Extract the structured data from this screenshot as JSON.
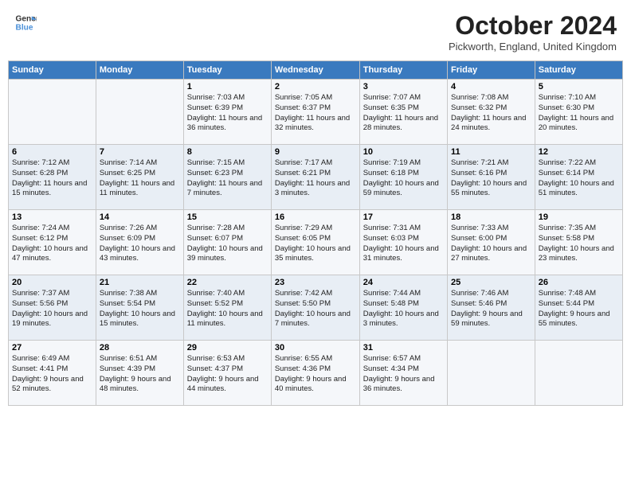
{
  "logo": {
    "line1": "General",
    "line2": "Blue"
  },
  "title": "October 2024",
  "subtitle": "Pickworth, England, United Kingdom",
  "days_of_week": [
    "Sunday",
    "Monday",
    "Tuesday",
    "Wednesday",
    "Thursday",
    "Friday",
    "Saturday"
  ],
  "weeks": [
    [
      {
        "day": "",
        "info": ""
      },
      {
        "day": "",
        "info": ""
      },
      {
        "day": "1",
        "info": "Sunrise: 7:03 AM\nSunset: 6:39 PM\nDaylight: 11 hours and 36 minutes."
      },
      {
        "day": "2",
        "info": "Sunrise: 7:05 AM\nSunset: 6:37 PM\nDaylight: 11 hours and 32 minutes."
      },
      {
        "day": "3",
        "info": "Sunrise: 7:07 AM\nSunset: 6:35 PM\nDaylight: 11 hours and 28 minutes."
      },
      {
        "day": "4",
        "info": "Sunrise: 7:08 AM\nSunset: 6:32 PM\nDaylight: 11 hours and 24 minutes."
      },
      {
        "day": "5",
        "info": "Sunrise: 7:10 AM\nSunset: 6:30 PM\nDaylight: 11 hours and 20 minutes."
      }
    ],
    [
      {
        "day": "6",
        "info": "Sunrise: 7:12 AM\nSunset: 6:28 PM\nDaylight: 11 hours and 15 minutes."
      },
      {
        "day": "7",
        "info": "Sunrise: 7:14 AM\nSunset: 6:25 PM\nDaylight: 11 hours and 11 minutes."
      },
      {
        "day": "8",
        "info": "Sunrise: 7:15 AM\nSunset: 6:23 PM\nDaylight: 11 hours and 7 minutes."
      },
      {
        "day": "9",
        "info": "Sunrise: 7:17 AM\nSunset: 6:21 PM\nDaylight: 11 hours and 3 minutes."
      },
      {
        "day": "10",
        "info": "Sunrise: 7:19 AM\nSunset: 6:18 PM\nDaylight: 10 hours and 59 minutes."
      },
      {
        "day": "11",
        "info": "Sunrise: 7:21 AM\nSunset: 6:16 PM\nDaylight: 10 hours and 55 minutes."
      },
      {
        "day": "12",
        "info": "Sunrise: 7:22 AM\nSunset: 6:14 PM\nDaylight: 10 hours and 51 minutes."
      }
    ],
    [
      {
        "day": "13",
        "info": "Sunrise: 7:24 AM\nSunset: 6:12 PM\nDaylight: 10 hours and 47 minutes."
      },
      {
        "day": "14",
        "info": "Sunrise: 7:26 AM\nSunset: 6:09 PM\nDaylight: 10 hours and 43 minutes."
      },
      {
        "day": "15",
        "info": "Sunrise: 7:28 AM\nSunset: 6:07 PM\nDaylight: 10 hours and 39 minutes."
      },
      {
        "day": "16",
        "info": "Sunrise: 7:29 AM\nSunset: 6:05 PM\nDaylight: 10 hours and 35 minutes."
      },
      {
        "day": "17",
        "info": "Sunrise: 7:31 AM\nSunset: 6:03 PM\nDaylight: 10 hours and 31 minutes."
      },
      {
        "day": "18",
        "info": "Sunrise: 7:33 AM\nSunset: 6:00 PM\nDaylight: 10 hours and 27 minutes."
      },
      {
        "day": "19",
        "info": "Sunrise: 7:35 AM\nSunset: 5:58 PM\nDaylight: 10 hours and 23 minutes."
      }
    ],
    [
      {
        "day": "20",
        "info": "Sunrise: 7:37 AM\nSunset: 5:56 PM\nDaylight: 10 hours and 19 minutes."
      },
      {
        "day": "21",
        "info": "Sunrise: 7:38 AM\nSunset: 5:54 PM\nDaylight: 10 hours and 15 minutes."
      },
      {
        "day": "22",
        "info": "Sunrise: 7:40 AM\nSunset: 5:52 PM\nDaylight: 10 hours and 11 minutes."
      },
      {
        "day": "23",
        "info": "Sunrise: 7:42 AM\nSunset: 5:50 PM\nDaylight: 10 hours and 7 minutes."
      },
      {
        "day": "24",
        "info": "Sunrise: 7:44 AM\nSunset: 5:48 PM\nDaylight: 10 hours and 3 minutes."
      },
      {
        "day": "25",
        "info": "Sunrise: 7:46 AM\nSunset: 5:46 PM\nDaylight: 9 hours and 59 minutes."
      },
      {
        "day": "26",
        "info": "Sunrise: 7:48 AM\nSunset: 5:44 PM\nDaylight: 9 hours and 55 minutes."
      }
    ],
    [
      {
        "day": "27",
        "info": "Sunrise: 6:49 AM\nSunset: 4:41 PM\nDaylight: 9 hours and 52 minutes."
      },
      {
        "day": "28",
        "info": "Sunrise: 6:51 AM\nSunset: 4:39 PM\nDaylight: 9 hours and 48 minutes."
      },
      {
        "day": "29",
        "info": "Sunrise: 6:53 AM\nSunset: 4:37 PM\nDaylight: 9 hours and 44 minutes."
      },
      {
        "day": "30",
        "info": "Sunrise: 6:55 AM\nSunset: 4:36 PM\nDaylight: 9 hours and 40 minutes."
      },
      {
        "day": "31",
        "info": "Sunrise: 6:57 AM\nSunset: 4:34 PM\nDaylight: 9 hours and 36 minutes."
      },
      {
        "day": "",
        "info": ""
      },
      {
        "day": "",
        "info": ""
      }
    ]
  ]
}
